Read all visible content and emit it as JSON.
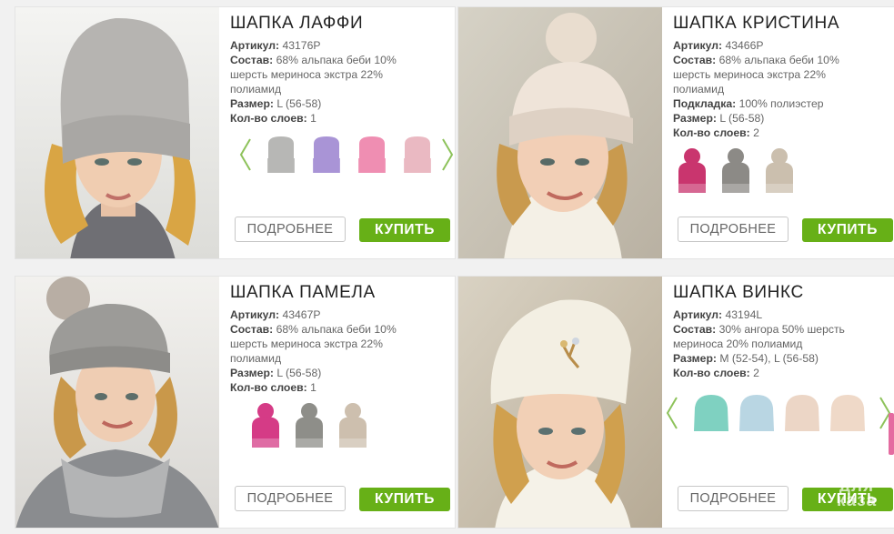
{
  "labels": {
    "article": "Артикул:",
    "composition": "Состав:",
    "lining": "Подкладка:",
    "size": "Размер:",
    "layers": "Кол-во слоев:"
  },
  "buttons": {
    "more": "ПОДРОБНЕЕ",
    "buy": "КУПИТЬ"
  },
  "watermark": "для\nказа",
  "colors": {
    "buy_green": "#67b017",
    "arrow_green": "#8dc25a"
  },
  "products": [
    {
      "title": "ШАПКА ЛАФФИ",
      "article": "43176Р",
      "composition_lines": [
        "68% альпака беби 10%",
        "шерсть мериноса экстра 22%",
        "полиамид"
      ],
      "size": "L (56-58)",
      "layers": "1",
      "swatch_colors": [
        "#b7b7b5",
        "#a994d6",
        "#ef8eb2",
        "#eab9c2"
      ]
    },
    {
      "title": "ШАПКА КРИСТИНА",
      "article": "43466Р",
      "composition_lines": [
        "68% альпака беби 10%",
        "шерсть мериноса экстра 22%",
        "полиамид"
      ],
      "lining": "100% полиэстер",
      "size": "L (56-58)",
      "layers": "2",
      "swatch_colors": [
        "#c9356e",
        "#8c8a86",
        "#cbbfae"
      ]
    },
    {
      "title": "ШАПКА ПАМЕЛА",
      "article": "43467Р",
      "composition_lines": [
        "68% альпака беби 10%",
        "шерсть мериноса экстра 22%",
        "полиамид"
      ],
      "size": "L (56-58)",
      "layers": "1",
      "swatch_colors": [
        "#d53b86",
        "#8e8e89",
        "#cdbfae"
      ]
    },
    {
      "title": "ШАПКА ВИНКС",
      "article": "43194L",
      "composition_lines": [
        "30% ангора 50% шерсть",
        "мериноса 20% полиамид"
      ],
      "size": "M (52-54), L (56-58)",
      "layers": "2",
      "swatch_colors": [
        "#7fd1c1",
        "#b9d6e3",
        "#ecd6c6",
        "#efd9c8"
      ]
    }
  ]
}
